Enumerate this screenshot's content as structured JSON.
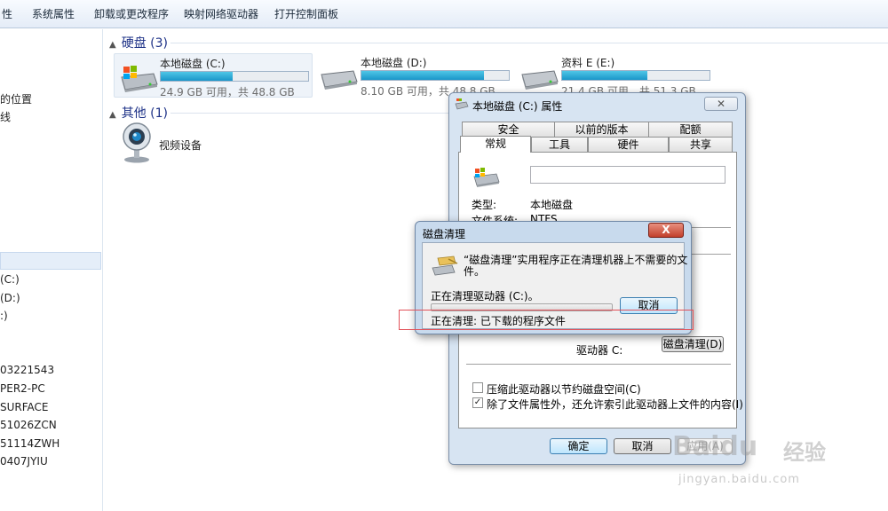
{
  "toolbar": {
    "items": [
      "性",
      "系统属性",
      "卸载或更改程序",
      "映射网络驱动器",
      "打开控制面板"
    ]
  },
  "sidebar": {
    "items": [
      "的位置",
      "线",
      "(C:)",
      "(D:)",
      ":)",
      "03221543",
      "PER2-PC",
      "SURFACE",
      "51026ZCN",
      "51114ZWH",
      "0407JYIU"
    ]
  },
  "explorer": {
    "hard_disks_header": "硬盘 (3)",
    "other_header": "其他 (1)",
    "drives": [
      {
        "name": "本地磁盘 (C:)",
        "info": "24.9 GB 可用，共 48.8 GB",
        "used_fraction": 0.49
      },
      {
        "name": "本地磁盘 (D:)",
        "info": "8.10 GB 可用，共 48.8 GB",
        "used_fraction": 0.83
      },
      {
        "name": "资料 E (E:)",
        "info": "21.4 GB 可用，共 51.3 GB",
        "used_fraction": 0.58
      }
    ],
    "other_device": "视频设备"
  },
  "properties_dialog": {
    "title": "本地磁盘 (C:) 属性",
    "close": "✕",
    "tabs_row1": [
      "安全",
      "以前的版本",
      "配额"
    ],
    "tabs_row2": [
      "常规",
      "工具",
      "硬件",
      "共享"
    ],
    "type_label": "类型:",
    "type_value": "本地磁盘",
    "fs_label": "文件系统:",
    "fs_value": "NTFS",
    "drive_label": "驱动器 C:",
    "cleanup_button": "磁盘清理(D)",
    "compress_checkbox": "压缩此驱动器以节约磁盘空间(C)",
    "index_checkbox": "除了文件属性外，还允许索引此驱动器上文件的内容(I)",
    "ok": "确定",
    "cancel": "取消",
    "apply": "应用(A)"
  },
  "cleanup_dialog": {
    "title": "磁盘清理",
    "close": "X",
    "message_line1": "“磁盘清理”实用程序正在清理机器上不需要的文",
    "message_line2": "件。",
    "cleaning_drive": "正在清理驱动器  (C:)。",
    "cancel": "取消",
    "current_item": "正在清理: 已下载的程序文件",
    "progress": 0
  },
  "watermark": {
    "brand": "Baidu",
    "cn": "经验",
    "url": "jingyan.baidu.com"
  },
  "colors": {
    "drive_fill": "#1a96c9",
    "highlight_box": "#e2525a",
    "close_red": "#c2402c"
  }
}
